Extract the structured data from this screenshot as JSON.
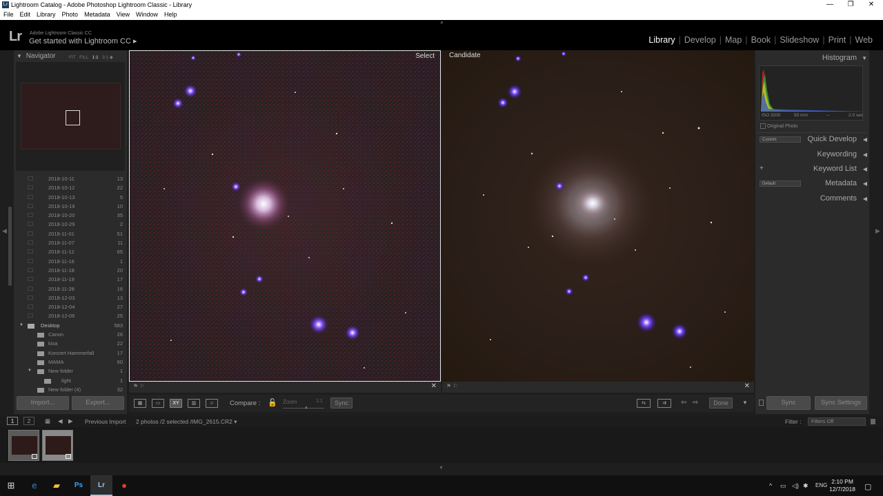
{
  "window": {
    "title": "Lightroom Catalog - Adobe Photoshop Lightroom Classic - Library",
    "icon_label": "Lr",
    "minimize": "—",
    "maximize": "❐",
    "close": "✕"
  },
  "menu": [
    "File",
    "Edit",
    "Library",
    "Photo",
    "Metadata",
    "View",
    "Window",
    "Help"
  ],
  "identity": {
    "logo": "Lr",
    "small": "Adobe Lightroom Classic CC",
    "main": "Get started with Lightroom CC ▸"
  },
  "modules": [
    {
      "label": "Library",
      "active": true
    },
    {
      "label": "Develop"
    },
    {
      "label": "Map"
    },
    {
      "label": "Book"
    },
    {
      "label": "Slideshow"
    },
    {
      "label": "Print"
    },
    {
      "label": "Web"
    }
  ],
  "navigator": {
    "title": "Navigator",
    "zoom": [
      "FIT",
      "FILL",
      "1:1",
      "3:1"
    ]
  },
  "folders": [
    {
      "name": "2018-10-11",
      "count": "13"
    },
    {
      "name": "2018-10-12",
      "count": "22"
    },
    {
      "name": "2018-10-13",
      "count": "5"
    },
    {
      "name": "2018-10-19",
      "count": "10"
    },
    {
      "name": "2018-10-20",
      "count": "35"
    },
    {
      "name": "2018-10-29",
      "count": "2"
    },
    {
      "name": "2018-11-01",
      "count": "51"
    },
    {
      "name": "2018-11-07",
      "count": "11"
    },
    {
      "name": "2018-11-12",
      "count": "65"
    },
    {
      "name": "2018-11-16",
      "count": "1"
    },
    {
      "name": "2018-11-18",
      "count": "20"
    },
    {
      "name": "2018-11-19",
      "count": "17"
    },
    {
      "name": "2018-11-28",
      "count": "16"
    },
    {
      "name": "2018-12-03",
      "count": "13"
    },
    {
      "name": "2018-12-04",
      "count": "27"
    },
    {
      "name": "2018-12-06",
      "count": "25"
    }
  ],
  "desktop_folders": [
    {
      "name": "Desktop",
      "count": "583",
      "level": 0,
      "expanded": true
    },
    {
      "name": "Canon",
      "count": "26",
      "level": 1
    },
    {
      "name": "kisa",
      "count": "22",
      "level": 1
    },
    {
      "name": "Koncert Hammerfall",
      "count": "17",
      "level": 1
    },
    {
      "name": "MAMA",
      "count": "60",
      "level": 1
    },
    {
      "name": "New folder",
      "count": "1",
      "level": 1,
      "expanded": true
    },
    {
      "name": "light",
      "count": "1",
      "level": 2
    },
    {
      "name": "New folder (4)",
      "count": "32",
      "level": 1
    }
  ],
  "left_buttons": {
    "import": "Import...",
    "export": "Export..."
  },
  "compare": {
    "select_label": "Select",
    "candidate_label": "Candidate",
    "compare_label": "Compare :",
    "zoom_label": "Zoom",
    "zoom_value": "1:1",
    "sync": "Sync",
    "done": "Done"
  },
  "right_panel": {
    "histogram": "Histogram",
    "iso": "ISO 3200",
    "focal": "50 mm",
    "aperture": "–",
    "shutter": "2.0 sec",
    "original_photo": "Original Photo",
    "quick_develop": "Quick Develop",
    "quick_preset": "Custom",
    "keywording": "Keywording",
    "keyword_list": "Keyword List",
    "metadata": "Metadata",
    "metadata_preset": "Default",
    "comments": "Comments",
    "sync": "Sync",
    "sync_settings": "Sync Settings"
  },
  "filmbar": {
    "page1": "1",
    "page2": "2",
    "source": "Previous Import",
    "info": "2 photos /2 selected /IMG_2615.CR2 ▾",
    "filter_label": "Filter :",
    "filter_value": "Filters Off"
  },
  "taskbar": {
    "time": "2:10 PM",
    "date": "12/7/2018",
    "lang": "ENG"
  },
  "colors": {
    "accent": "#ffffff",
    "panel": "#2b2b2b",
    "star": "#7b3cff"
  }
}
